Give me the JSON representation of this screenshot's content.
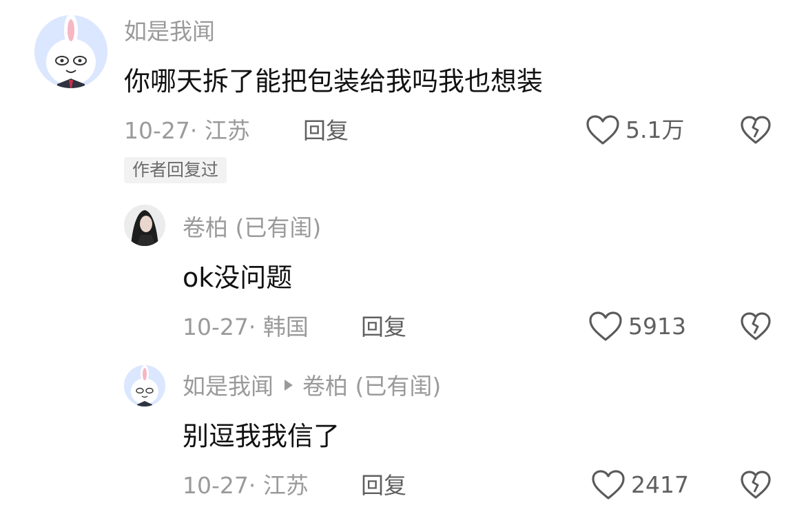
{
  "comments": [
    {
      "username": "如是我闻",
      "text": "你哪天拆了能把包装给我吗我也想装",
      "meta": "10-27· 江苏",
      "reply_label": "回复",
      "likes": "5.1万",
      "badge": "作者回复过"
    },
    {
      "username": "卷柏 (已有闺)",
      "text": "ok没问题",
      "meta": "10-27· 韩国",
      "reply_label": "回复",
      "likes": "5913"
    },
    {
      "username": "如是我闻",
      "reply_to": "卷柏 (已有闺)",
      "text": "别逗我我信了",
      "meta": "10-27· 江苏",
      "reply_label": "回复",
      "likes": "2417"
    }
  ],
  "icons": {
    "like": "heart-outline-icon",
    "dislike": "broken-heart-icon",
    "reply_arrow": "play-triangle-icon"
  },
  "colors": {
    "text_primary": "#111111",
    "text_secondary": "#9a9a9a",
    "action_text": "#5f5f5f",
    "badge_bg": "#f2f2f2"
  }
}
